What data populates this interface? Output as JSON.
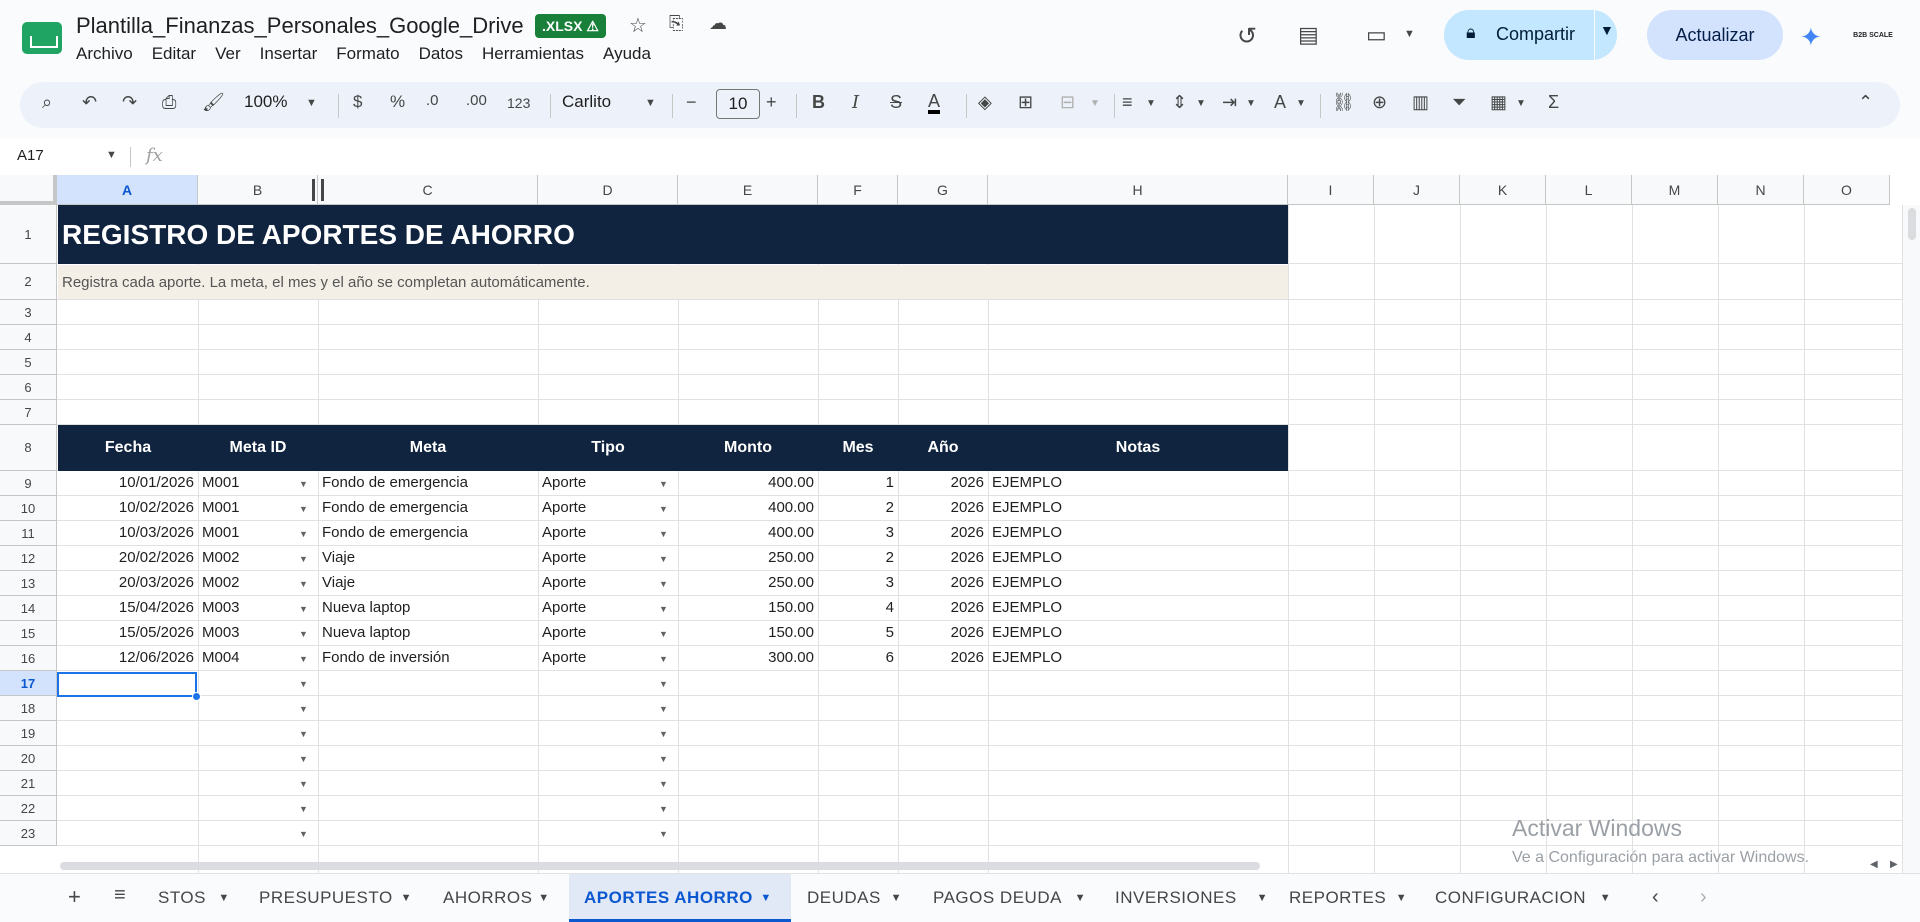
{
  "header": {
    "doc_title": "Plantilla_Finanzas_Personales_Google_Drive",
    "badge": ".XLSX ⚠",
    "menu": [
      "Archivo",
      "Editar",
      "Ver",
      "Insertar",
      "Formato",
      "Datos",
      "Herramientas",
      "Ayuda"
    ],
    "share_label": "Compartir",
    "update_label": "Actualizar",
    "avatar_text": "B2B SCALE"
  },
  "toolbar": {
    "zoom": "100%",
    "currency": "$",
    "percent": "%",
    "dec_decrease": ".0",
    "dec_increase": ".00",
    "number_format": "123",
    "font": "Carlito",
    "font_size": "10"
  },
  "formula_bar": {
    "cell_ref": "A17",
    "fx": "fx"
  },
  "grid": {
    "columns": [
      "A",
      "B",
      "C",
      "D",
      "E",
      "F",
      "G",
      "H",
      "I",
      "J",
      "K",
      "L",
      "M",
      "N",
      "O"
    ],
    "rows": [
      "1",
      "2",
      "3",
      "4",
      "5",
      "6",
      "7",
      "8",
      "9",
      "10",
      "11",
      "12",
      "13",
      "14",
      "15",
      "16",
      "17",
      "18",
      "19",
      "20",
      "21",
      "22",
      "23"
    ],
    "title": "REGISTRO DE APORTES DE AHORRO",
    "subtitle": "Registra cada aporte. La meta, el mes y el año se completan automáticamente.",
    "headers": [
      "Fecha",
      "Meta ID",
      "Meta",
      "Tipo",
      "Monto",
      "Mes",
      "Año",
      "Notas"
    ],
    "data_rows": [
      {
        "fecha": "10/01/2026",
        "meta_id": "M001",
        "meta": "Fondo de emergencia",
        "tipo": "Aporte",
        "monto": "400.00",
        "mes": "1",
        "anio": "2026",
        "notas": "EJEMPLO"
      },
      {
        "fecha": "10/02/2026",
        "meta_id": "M001",
        "meta": "Fondo de emergencia",
        "tipo": "Aporte",
        "monto": "400.00",
        "mes": "2",
        "anio": "2026",
        "notas": "EJEMPLO"
      },
      {
        "fecha": "10/03/2026",
        "meta_id": "M001",
        "meta": "Fondo de emergencia",
        "tipo": "Aporte",
        "monto": "400.00",
        "mes": "3",
        "anio": "2026",
        "notas": "EJEMPLO"
      },
      {
        "fecha": "20/02/2026",
        "meta_id": "M002",
        "meta": "Viaje",
        "tipo": "Aporte",
        "monto": "250.00",
        "mes": "2",
        "anio": "2026",
        "notas": "EJEMPLO"
      },
      {
        "fecha": "20/03/2026",
        "meta_id": "M002",
        "meta": "Viaje",
        "tipo": "Aporte",
        "monto": "250.00",
        "mes": "3",
        "anio": "2026",
        "notas": "EJEMPLO"
      },
      {
        "fecha": "15/04/2026",
        "meta_id": "M003",
        "meta": "Nueva laptop",
        "tipo": "Aporte",
        "monto": "150.00",
        "mes": "4",
        "anio": "2026",
        "notas": "EJEMPLO"
      },
      {
        "fecha": "15/05/2026",
        "meta_id": "M003",
        "meta": "Nueva laptop",
        "tipo": "Aporte",
        "monto": "150.00",
        "mes": "5",
        "anio": "2026",
        "notas": "EJEMPLO"
      },
      {
        "fecha": "12/06/2026",
        "meta_id": "M004",
        "meta": "Fondo de inversión",
        "tipo": "Aporte",
        "monto": "300.00",
        "mes": "6",
        "anio": "2026",
        "notas": "EJEMPLO"
      }
    ],
    "selected_row": "17",
    "selected_col": "A"
  },
  "watermark": {
    "line1": "Activar Windows",
    "line2": "Ve a Configuración para activar Windows."
  },
  "tabs": [
    {
      "label": "STOS",
      "active": false
    },
    {
      "label": "PRESUPUESTO",
      "active": false
    },
    {
      "label": "AHORROS",
      "active": false
    },
    {
      "label": "APORTES AHORRO",
      "active": true
    },
    {
      "label": "DEUDAS",
      "active": false
    },
    {
      "label": "PAGOS DEUDA",
      "active": false
    },
    {
      "label": "INVERSIONES",
      "active": false
    },
    {
      "label": "REPORTES",
      "active": false
    },
    {
      "label": "CONFIGURACION",
      "active": false
    }
  ]
}
